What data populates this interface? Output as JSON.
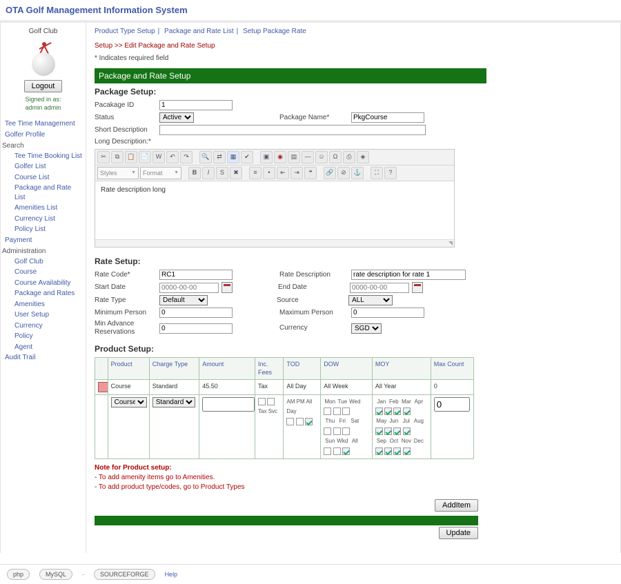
{
  "app_title": "OTA Golf Management Information System",
  "sidebar": {
    "logo_caption": "Golf Club",
    "logout": "Logout",
    "signed_label": "Signed in as:",
    "signed_user": "admin admin",
    "nav": {
      "top1": "Tee Time Management",
      "top2": "Golfer Profile",
      "search": "Search",
      "s1": "Tee Time Booking List",
      "s2": "Golfer List",
      "s3": "Course List",
      "s4": "Package and Rate List",
      "s5": "Amenities List",
      "s6": "Currency List",
      "s7": "Policy List",
      "payment": "Payment",
      "admin": "Administration",
      "a1": "Golf Club",
      "a2": "Course",
      "a3": "Course Availability",
      "a4": "Package and Rates",
      "a5": "Amenities",
      "a6": "User Setup",
      "a7": "Currency",
      "a8": "Policy",
      "a9": "Agent",
      "audit": "Audit Trail"
    }
  },
  "crumbs": {
    "c1": "Product Type Setup",
    "c2": "Package and Rate List",
    "c3": "Setup Package Rate"
  },
  "setup_line": "Setup >> Edit Package and Rate Setup",
  "req_line": "* Indicates required field",
  "section_bar": "Package and Rate Setup",
  "pkg": {
    "heading": "Package Setup:",
    "id_lbl": "Pacakage ID",
    "id_val": "1",
    "status_lbl": "Status",
    "status_val": "Active",
    "name_lbl": "Package Name*",
    "name_val": "PkgCourse",
    "short_lbl": "Short Description",
    "short_val": "",
    "long_lbl": "Long Description:*",
    "editor": {
      "styles": "Styles",
      "format": "Format",
      "content": "Rate description long"
    }
  },
  "rate": {
    "heading": "Rate Setup:",
    "code_lbl": "Rate Code*",
    "code_val": "RC1",
    "desc_lbl": "Rate Description",
    "desc_val": "rate description for rate 1",
    "start_lbl": "Start Date",
    "start_ph": "0000-00-00",
    "end_lbl": "End Date",
    "end_ph": "0000-00-00",
    "type_lbl": "Rate Type",
    "type_val": "Default",
    "src_lbl": "Source",
    "src_val": "ALL",
    "min_lbl": "Minimum Person",
    "min_val": "0",
    "max_lbl": "Maximum Person",
    "max_val": "0",
    "adv_lbl": "Min Advance Reservations",
    "adv_val": "0",
    "cur_lbl": "Currency",
    "cur_val": "SGD"
  },
  "product": {
    "heading": "Product Setup:",
    "cols": {
      "c1": "",
      "c2": "Product",
      "c3": "Charge Type",
      "c4": "Amount",
      "c5": "Inc. Fees",
      "c6": "TOD",
      "c7": "DOW",
      "c8": "MOY",
      "c9": "Max Count"
    },
    "row1": {
      "product": "Course",
      "charge": "Standard",
      "amount": "45.50",
      "fees": "Tax",
      "tod": "All Day",
      "dow": "All Week",
      "moy": "All Year",
      "max": "0"
    },
    "row2": {
      "product_val": "Course",
      "charge_val": "Standard",
      "amount_val": "",
      "max_val": "0",
      "fees": {
        "tax": "Tax",
        "svc": "Svc"
      },
      "tod": {
        "am": "AM",
        "pm": "PM",
        "all": "All Day"
      },
      "dow": {
        "mon": "Mon",
        "tue": "Tue",
        "wed": "Wed",
        "thu": "Thu",
        "fri": "Fri",
        "sat": "Sat",
        "sun": "Sun",
        "wkd": "Wkd",
        "all": "All"
      },
      "moy": {
        "jan": "Jan",
        "feb": "Feb",
        "mar": "Mar",
        "apr": "Apr",
        "may": "May",
        "jun": "Jun",
        "jul": "Jul",
        "aug": "Aug",
        "sep": "Sep",
        "oct": "Oct",
        "nov": "Nov",
        "dec": "Dec"
      }
    },
    "note_hdr": "Note for Product setup:",
    "note1": "- To add amenity items go to Amenities.",
    "note2": "- To add product type/codes, go to Product Types"
  },
  "buttons": {
    "additem": "AddItem",
    "update": "Update"
  },
  "footer": {
    "copyright": "-                    ",
    "help": "Help"
  }
}
